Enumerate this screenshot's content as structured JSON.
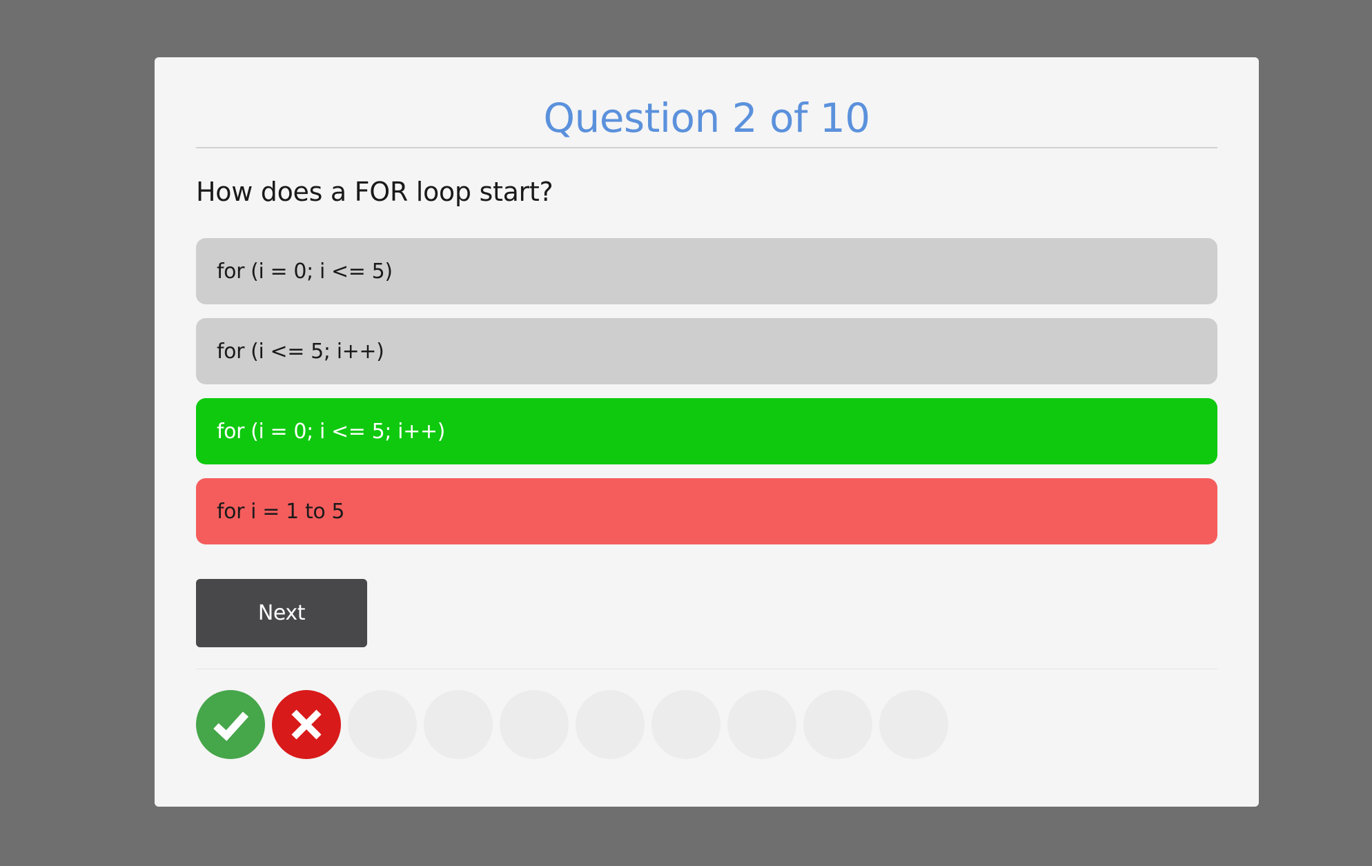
{
  "quiz": {
    "title": "Question 2 of 10",
    "question": "How does a FOR loop start?",
    "answers": [
      {
        "label": "for (i = 0; i <= 5)",
        "state": "neutral"
      },
      {
        "label": "for (i <= 5; i++)",
        "state": "neutral"
      },
      {
        "label": "for (i = 0; i <= 5; i++)",
        "state": "correct"
      },
      {
        "label": "for i = 1 to 5",
        "state": "wrong"
      }
    ],
    "next_label": "Next"
  },
  "progress": {
    "items": [
      {
        "status": "correct",
        "icon": "check-icon"
      },
      {
        "status": "wrong",
        "icon": "cross-icon"
      },
      {
        "status": "pending"
      },
      {
        "status": "pending"
      },
      {
        "status": "pending"
      },
      {
        "status": "pending"
      },
      {
        "status": "pending"
      },
      {
        "status": "pending"
      },
      {
        "status": "pending"
      },
      {
        "status": "pending"
      }
    ]
  },
  "colors": {
    "title": "#5b91dc",
    "correct": "#0fc90f",
    "wrong": "#f55d5d",
    "neutral": "#cecece",
    "button": "#48484a",
    "progress_correct": "#46a64a",
    "progress_wrong": "#d91a1a"
  }
}
